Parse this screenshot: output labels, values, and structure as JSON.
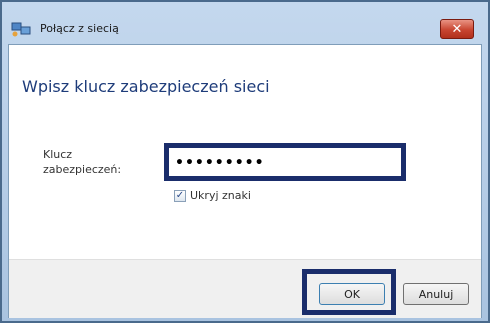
{
  "window": {
    "title": "Połącz z siecią",
    "close_label": "✕"
  },
  "dialog": {
    "heading": "Wpisz klucz zabezpieczeń sieci",
    "security_key_label": "Klucz zabezpieczeń:",
    "security_key_value": "•••••••••",
    "hide_chars_label": "Ukryj znaki",
    "hide_chars_checked": true,
    "checkmark": "✓"
  },
  "buttons": {
    "ok_label": "OK",
    "cancel_label": "Anuluj"
  },
  "colors": {
    "highlight_frame": "#1a2d6b",
    "heading": "#1e3c7a",
    "close_button": "#c84531"
  }
}
